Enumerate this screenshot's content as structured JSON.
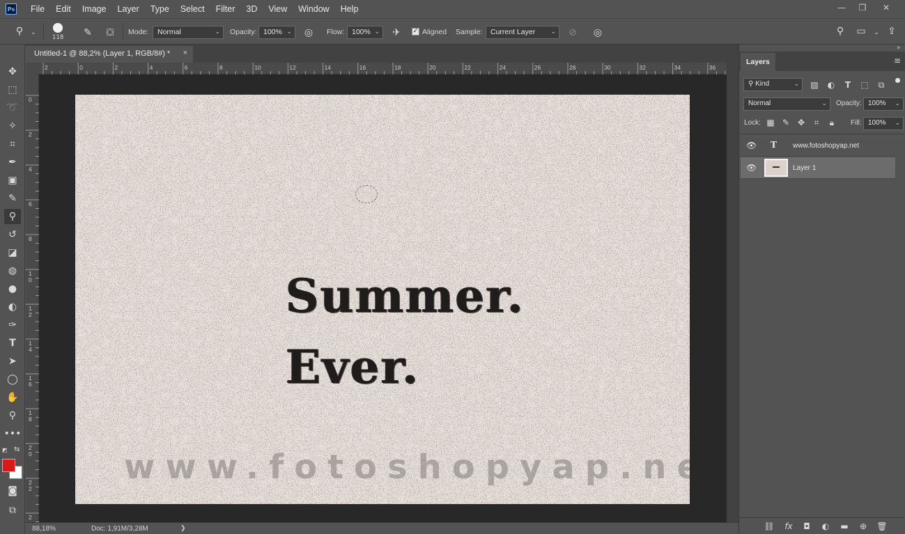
{
  "app": {
    "logo": "Ps"
  },
  "menu": [
    "File",
    "Edit",
    "Image",
    "Layer",
    "Type",
    "Select",
    "Filter",
    "3D",
    "View",
    "Window",
    "Help"
  ],
  "window_controls": {
    "minimize": "—",
    "restore": "❐",
    "close": "✕"
  },
  "options_bar": {
    "brush_size": "118",
    "mode_label": "Mode:",
    "mode_value": "Normal",
    "opacity_label": "Opacity:",
    "opacity_value": "100%",
    "flow_label": "Flow:",
    "flow_value": "100%",
    "aligned_label": "Aligned",
    "aligned_checked": true,
    "sample_label": "Sample:",
    "sample_value": "Current Layer"
  },
  "document": {
    "tab_title": "Untitled-1 @ 88,2% (Layer 1, RGB/8#) *",
    "close": "×"
  },
  "ruler": {
    "h_labels": [
      "2",
      "0",
      "2",
      "4",
      "6",
      "8",
      "10",
      "12",
      "14",
      "16",
      "18",
      "20",
      "22",
      "24",
      "26",
      "28",
      "30",
      "32",
      "34",
      "36"
    ],
    "v_labels": [
      "0",
      "2",
      "4",
      "6",
      "8",
      "1\n0",
      "1\n2",
      "1\n4",
      "1\n6",
      "1\n8",
      "2\n0",
      "2\n2",
      "2"
    ]
  },
  "canvas": {
    "headline_1": "Summer.",
    "headline_2": "Ever.",
    "watermark": "www.fotoshopyap.net"
  },
  "status": {
    "zoom": "88,18%",
    "doc_info": "Doc: 1,91M/3,28M",
    "arrow": "❯"
  },
  "layers_panel": {
    "tab_label": "Layers",
    "filter_kind": "Kind",
    "blend_mode": "Normal",
    "opacity_label": "Opacity:",
    "opacity_value": "100%",
    "lock_label": "Lock:",
    "fill_label": "Fill:",
    "fill_value": "100%",
    "layers": [
      {
        "name": "www.fotoshopyap.net",
        "type": "text",
        "selected": false
      },
      {
        "name": "Layer 1",
        "type": "pixel",
        "selected": true
      }
    ]
  },
  "colors": {
    "foreground": "#d61a1a",
    "background": "#ffffff"
  }
}
